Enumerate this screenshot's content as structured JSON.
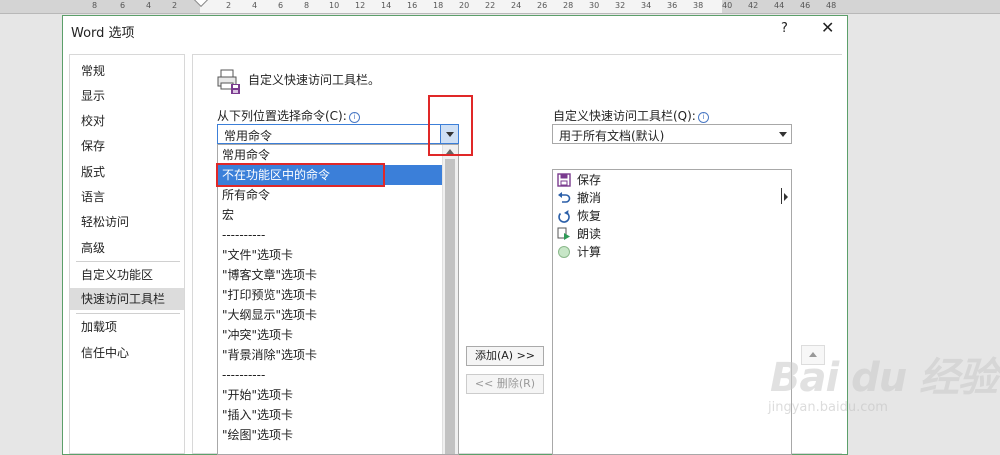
{
  "ruler": {
    "labels": [
      "8",
      "6",
      "4",
      "2",
      "2",
      "4",
      "6",
      "8",
      "10",
      "12",
      "14",
      "16",
      "18",
      "20",
      "22",
      "24",
      "26",
      "28",
      "30",
      "32",
      "34",
      "36",
      "38",
      "40",
      "42",
      "44",
      "46",
      "48"
    ]
  },
  "dialog": {
    "title": "Word 选项",
    "help": "?",
    "close": "✕"
  },
  "nav": {
    "items": [
      "常规",
      "显示",
      "校对",
      "保存",
      "版式",
      "语言",
      "轻松访问",
      "高级",
      "自定义功能区",
      "快速访问工具栏",
      "加载项",
      "信任中心"
    ],
    "selected": "快速访问工具栏"
  },
  "content": {
    "heading": "自定义快速访问工具栏。",
    "left_label": "从下列位置选择命令(C):",
    "right_label": "自定义快速访问工具栏(Q):",
    "left_combo_value": "常用命令",
    "right_combo_value": "用于所有文档(默认)",
    "dropdown_items": [
      "常用命令",
      "不在功能区中的命令",
      "所有命令",
      "宏",
      "----------",
      "\"文件\"选项卡",
      "\"博客文章\"选项卡",
      "\"打印预览\"选项卡",
      "\"大纲显示\"选项卡",
      "\"冲突\"选项卡",
      "\"背景消除\"选项卡",
      "----------",
      "\"开始\"选项卡",
      "\"插入\"选项卡",
      "\"绘图\"选项卡"
    ],
    "highlighted_item": "不在功能区中的命令",
    "add_button": "添加(A) >>",
    "remove_button": "<< 删除(R)",
    "qa_items": [
      {
        "label": "保存",
        "icon": "save-icon"
      },
      {
        "label": "撤消",
        "icon": "undo-icon"
      },
      {
        "label": "恢复",
        "icon": "redo-icon"
      },
      {
        "label": "朗读",
        "icon": "read-aloud-icon"
      },
      {
        "label": "计算",
        "icon": "calculate-icon"
      }
    ]
  },
  "watermark": {
    "brand": "Bai du 经验",
    "url": "jingyan.baidu.com"
  },
  "colors": {
    "accent": "#3b7fd9",
    "dialog_border": "#5c9f6a",
    "annotation_red": "#e02828"
  }
}
